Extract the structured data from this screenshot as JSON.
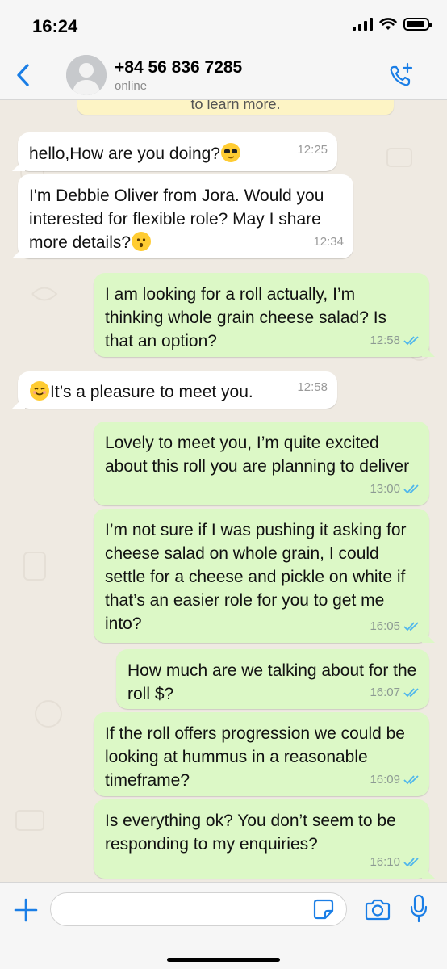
{
  "status_bar": {
    "time": "16:24",
    "battery_level": 0.9
  },
  "header": {
    "contact_name": "+84 56 836 7285",
    "contact_status": "online",
    "back_icon": "chevron-left-icon",
    "call_icon": "phone-plus-icon",
    "accent_color": "#1a7ee6"
  },
  "notice": {
    "text": "to learn more."
  },
  "messages": [
    {
      "direction": "in",
      "text": "hello,How are you doing?",
      "emoji_after": "sunglasses-emoji",
      "time": "12:25"
    },
    {
      "direction": "in",
      "text": "I'm Debbie Oliver from Jora. Would you interested for flexible role? May I share more details?",
      "emoji_after": "hushed-face-emoji",
      "time": "12:34"
    },
    {
      "direction": "out",
      "text": "I am looking for a roll actually, I’m thinking whole grain cheese salad? Is that an option?",
      "time": "12:58",
      "status": "read"
    },
    {
      "direction": "in",
      "text": "It’s a pleasure to meet you.",
      "emoji_before": "smiling-face-emoji",
      "time": "12:58"
    },
    {
      "direction": "out",
      "text": "Lovely to meet you, I’m quite excited about this roll you are planning to deliver",
      "time": "13:00",
      "status": "read"
    },
    {
      "direction": "out",
      "text": "I’m not sure if I was pushing it asking for cheese salad on whole grain, I could settle for a cheese and pickle on white if that’s an easier role for you to get me into?",
      "time": "16:05",
      "status": "read"
    },
    {
      "direction": "out",
      "text": "How much are we talking about for the roll $?",
      "time": "16:07",
      "status": "read"
    },
    {
      "direction": "out",
      "text": "If the roll offers progression we could be looking at hummus in a reasonable timeframe?",
      "time": "16:09",
      "status": "read"
    },
    {
      "direction": "out",
      "text": "Is everything ok? You don’t seem to be responding to my enquiries?",
      "time": "16:10",
      "status": "read"
    }
  ],
  "input_bar": {
    "placeholder": "",
    "plus_icon": "plus-icon",
    "sticker_icon": "sticker-icon",
    "camera_icon": "camera-icon",
    "mic_icon": "microphone-icon"
  },
  "colors": {
    "incoming_bubble": "#ffffff",
    "outgoing_bubble": "#dcf8c6",
    "chat_background": "#efeae2",
    "read_ticks": "#4fb6ec"
  }
}
